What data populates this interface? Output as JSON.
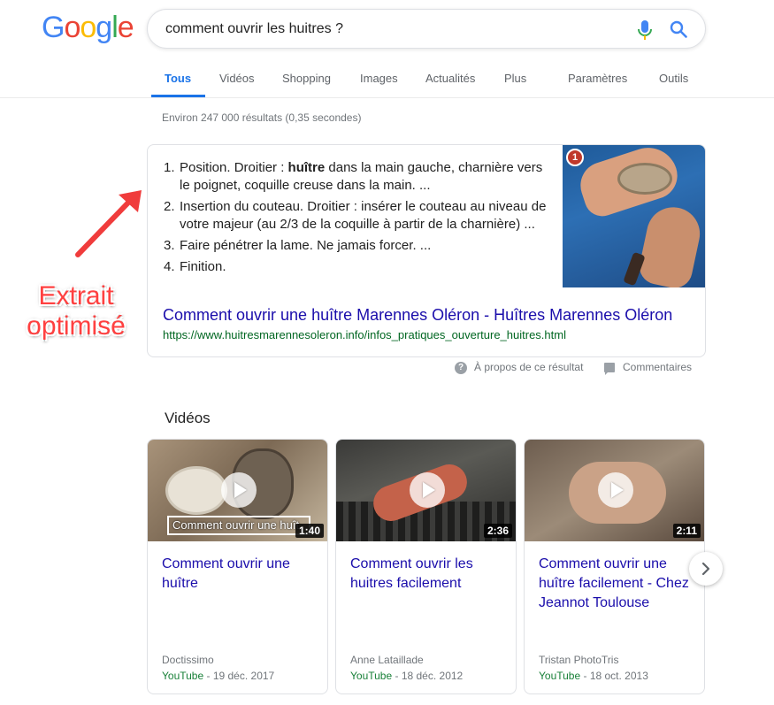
{
  "logo": {
    "letters": [
      "G",
      "o",
      "o",
      "g",
      "l",
      "e"
    ],
    "colors": [
      "#4285f4",
      "#ea4335",
      "#fbbc05",
      "#4285f4",
      "#34a853",
      "#ea4335"
    ]
  },
  "search": {
    "query": "comment ouvrir les huitres ?"
  },
  "tabs": [
    {
      "label": "Tous"
    },
    {
      "label": "Vidéos"
    },
    {
      "label": "Shopping"
    },
    {
      "label": "Images"
    },
    {
      "label": "Actualités"
    },
    {
      "label": "Plus"
    },
    {
      "label": "Paramètres"
    },
    {
      "label": "Outils"
    }
  ],
  "result_stats": "Environ 247 000 résultats (0,35 secondes)",
  "snippet": {
    "items": [
      {
        "num": "1.",
        "before": "Position. Droitier : ",
        "bold": "huître",
        "after": " dans la main gauche, charnière vers le poignet, coquille creuse dans la main. ..."
      },
      {
        "num": "2.",
        "before": "Insertion du couteau. Droitier : insérer le couteau au niveau de votre majeur (au 2/3 de la coquille à partir de la charnière) ...",
        "bold": "",
        "after": ""
      },
      {
        "num": "3.",
        "before": "Faire pénétrer la lame. Ne jamais forcer. ...",
        "bold": "",
        "after": ""
      },
      {
        "num": "4.",
        "before": "Finition.",
        "bold": "",
        "after": ""
      }
    ],
    "image_badge": "1",
    "title": "Comment ouvrir une huître Marennes Oléron - Huîtres Marennes Oléron",
    "url": "https://www.huitresmarennesoleron.info/infos_pratiques_ouverture_huitres.html"
  },
  "about": {
    "about_label": "À propos de ce résultat",
    "feedback_label": "Commentaires",
    "about_icon": "?"
  },
  "annotation": {
    "line1": "Extrait",
    "line2": "optimisé",
    "color": "#ff4040"
  },
  "videos": {
    "heading": "Vidéos",
    "items": [
      {
        "thumb_caption": "Comment ouvrir une huît",
        "duration": "1:40",
        "title": "Comment ouvrir une huître",
        "channel": "Doctissimo",
        "source": "YouTube",
        "date": " - 19 déc. 2017"
      },
      {
        "thumb_caption": "",
        "duration": "2:36",
        "title": "Comment ouvrir les huitres facilement",
        "channel": "Anne Lataillade",
        "source": "YouTube",
        "date": " - 18 déc. 2012"
      },
      {
        "thumb_caption": "",
        "duration": "2:11",
        "title": "Comment ouvrir une huître facilement - Chez Jeannot Toulouse",
        "channel": "Tristan PhotoTris",
        "source": "YouTube",
        "date": " - 18 oct. 2013"
      }
    ]
  },
  "colors": {
    "link": "#1a0dab",
    "url_green": "#006621",
    "accent": "#1a73e8",
    "youtube_green": "#188038"
  }
}
